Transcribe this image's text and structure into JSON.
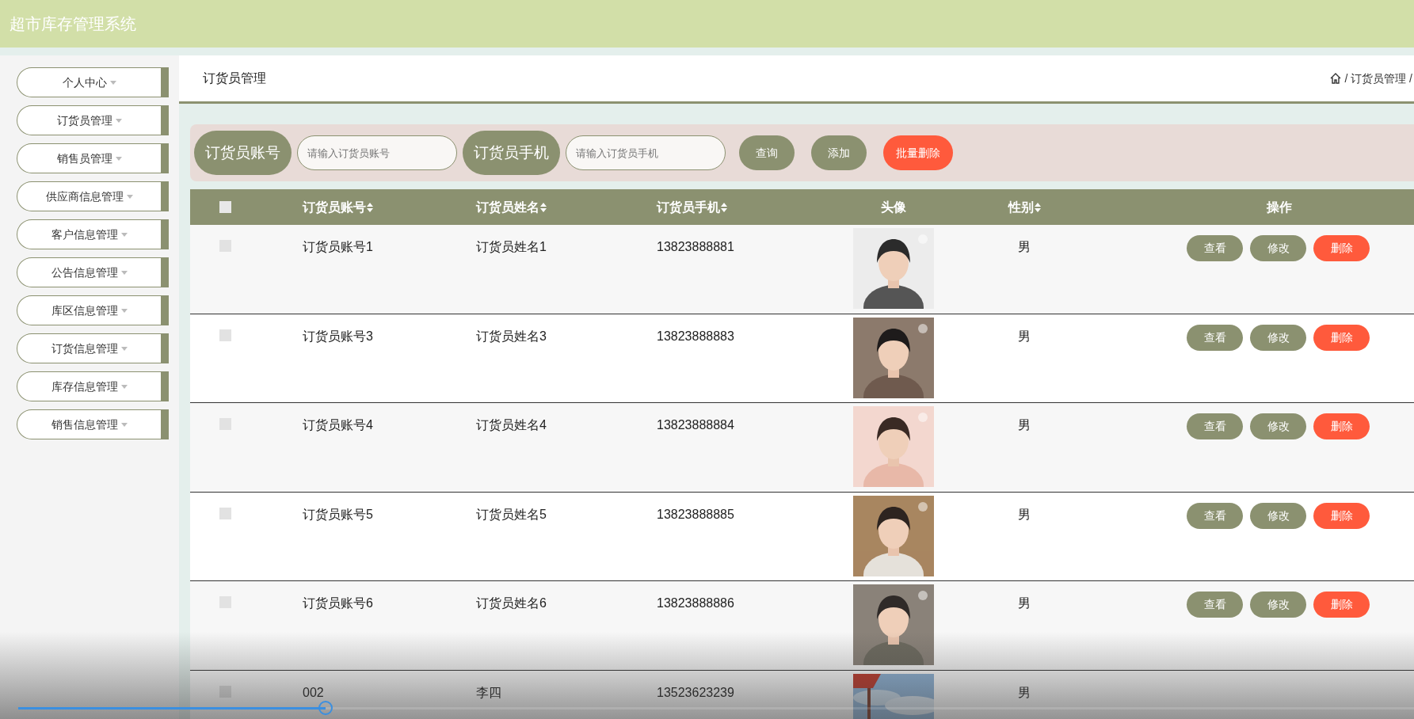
{
  "app_title": "超市库存管理系统",
  "sidebar": {
    "items": [
      {
        "label": "个人中心"
      },
      {
        "label": "订货员管理"
      },
      {
        "label": "销售员管理"
      },
      {
        "label": "供应商信息管理"
      },
      {
        "label": "客户信息管理"
      },
      {
        "label": "公告信息管理"
      },
      {
        "label": "库区信息管理"
      },
      {
        "label": "订货信息管理"
      },
      {
        "label": "库存信息管理"
      },
      {
        "label": "销售信息管理"
      }
    ]
  },
  "page_header": {
    "title": "订货员管理",
    "breadcrumb": "/ 订货员管理 /"
  },
  "search": {
    "fields": [
      {
        "label": "订货员账号",
        "placeholder": "请输入订货员账号"
      },
      {
        "label": "订货员手机",
        "placeholder": "请输入订货员手机"
      }
    ],
    "buttons": [
      {
        "label": "查询",
        "kind": "normal"
      },
      {
        "label": "添加",
        "kind": "normal"
      },
      {
        "label": "批量删除",
        "kind": "danger"
      }
    ]
  },
  "table": {
    "select_all": {
      "checked": false
    },
    "columns": [
      {
        "label": "订货员账号",
        "sortable": true
      },
      {
        "label": "订货员姓名",
        "sortable": true
      },
      {
        "label": "订货员手机",
        "sortable": true
      },
      {
        "label": "头像",
        "sortable": false
      },
      {
        "label": "性别",
        "sortable": true
      },
      {
        "label": "操作",
        "sortable": false
      }
    ],
    "rows": [
      {
        "checked": false,
        "account": "订货员账号1",
        "name": "订货员姓名1",
        "phone": "13823888881",
        "gender": "男",
        "actions": [
          {
            "label": "查看",
            "kind": "normal"
          },
          {
            "label": "修改",
            "kind": "normal"
          },
          {
            "label": "删除",
            "kind": "danger"
          }
        ]
      },
      {
        "checked": false,
        "account": "订货员账号3",
        "name": "订货员姓名3",
        "phone": "13823888883",
        "gender": "男",
        "actions": [
          {
            "label": "查看",
            "kind": "normal"
          },
          {
            "label": "修改",
            "kind": "normal"
          },
          {
            "label": "删除",
            "kind": "danger"
          }
        ]
      },
      {
        "checked": false,
        "account": "订货员账号4",
        "name": "订货员姓名4",
        "phone": "13823888884",
        "gender": "男",
        "actions": [
          {
            "label": "查看",
            "kind": "normal"
          },
          {
            "label": "修改",
            "kind": "normal"
          },
          {
            "label": "删除",
            "kind": "danger"
          }
        ]
      },
      {
        "checked": false,
        "account": "订货员账号5",
        "name": "订货员姓名5",
        "phone": "13823888885",
        "gender": "男",
        "actions": [
          {
            "label": "查看",
            "kind": "normal"
          },
          {
            "label": "修改",
            "kind": "normal"
          },
          {
            "label": "删除",
            "kind": "danger"
          }
        ]
      },
      {
        "checked": false,
        "account": "订货员账号6",
        "name": "订货员姓名6",
        "phone": "13823888886",
        "gender": "男",
        "actions": [
          {
            "label": "查看",
            "kind": "normal"
          },
          {
            "label": "修改",
            "kind": "normal"
          },
          {
            "label": "删除",
            "kind": "danger"
          }
        ]
      },
      {
        "checked": false,
        "account": "002",
        "name": "李四",
        "phone": "13523623239",
        "gender": "男"
      }
    ]
  },
  "video_player": {
    "level": 0.22
  }
}
